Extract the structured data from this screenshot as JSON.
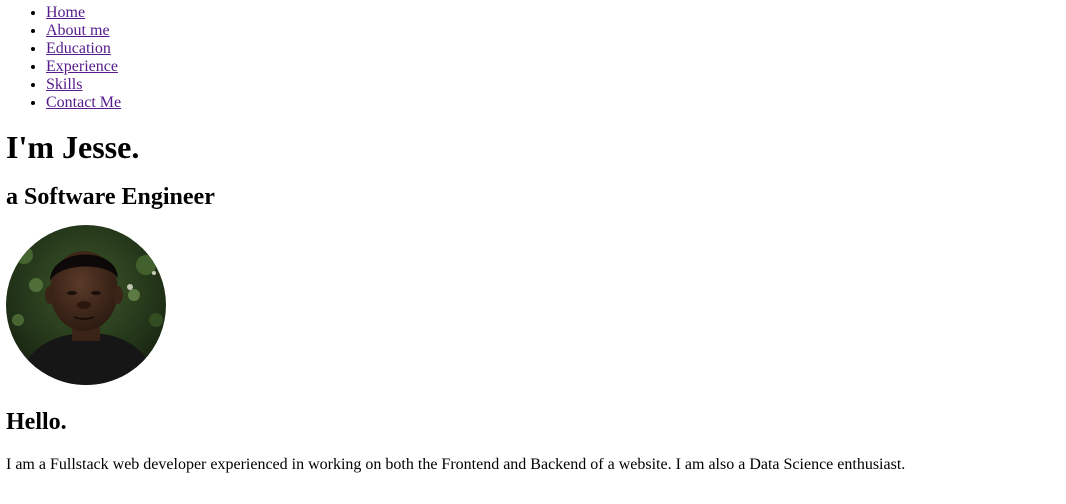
{
  "nav": {
    "items": [
      {
        "label": "Home"
      },
      {
        "label": "About me"
      },
      {
        "label": "Education"
      },
      {
        "label": "Experience"
      },
      {
        "label": "Skills"
      },
      {
        "label": "Contact Me"
      }
    ]
  },
  "hero": {
    "title": "I'm Jesse.",
    "subtitle": "a Software Engineer"
  },
  "about": {
    "greeting": "Hello.",
    "intro": "I am a Fullstack web developer experienced in working on both the Frontend and Backend of a website. I am also a Data Science enthusiast."
  },
  "colors": {
    "link": "#551a8b",
    "text": "#000000",
    "background": "#ffffff"
  }
}
